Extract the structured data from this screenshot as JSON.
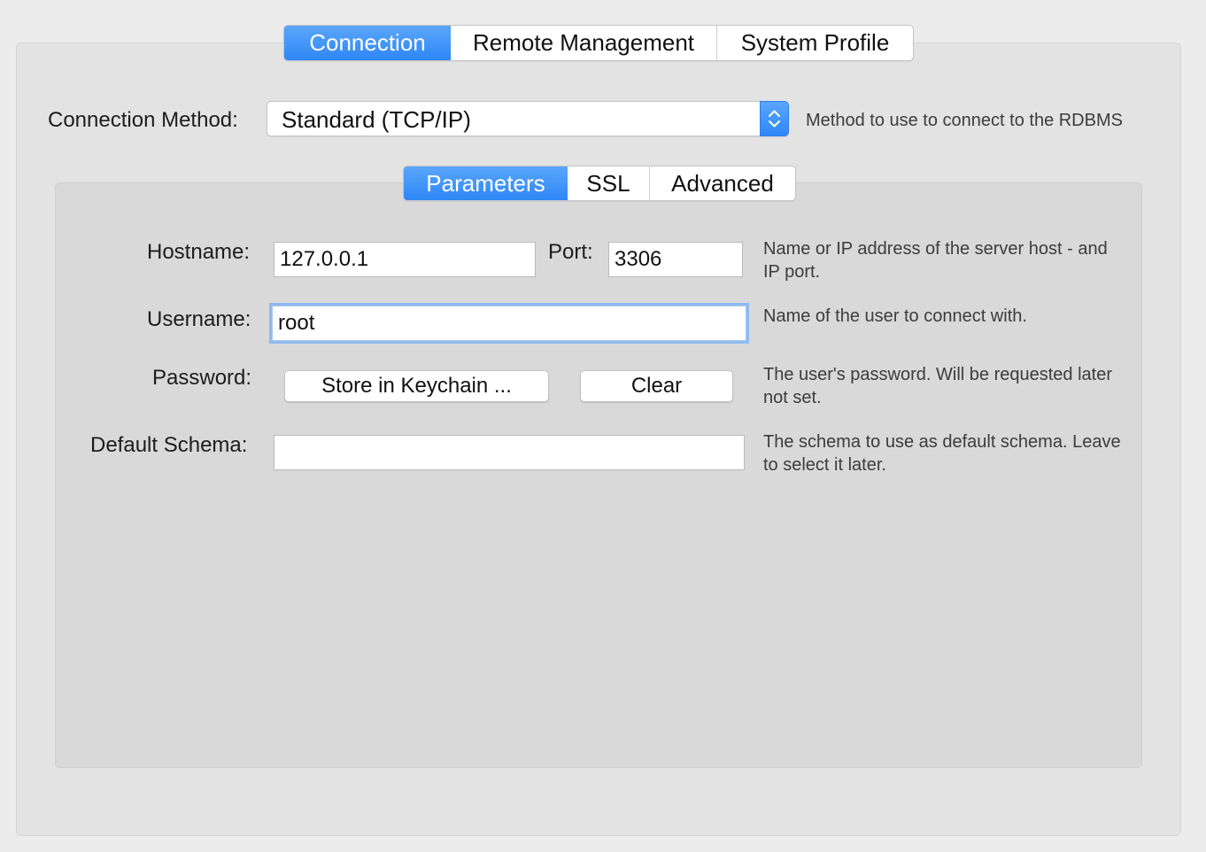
{
  "top_tabs": [
    {
      "label": "Connection",
      "active": true
    },
    {
      "label": "Remote Management",
      "active": false
    },
    {
      "label": "System Profile",
      "active": false
    }
  ],
  "connection_method": {
    "label": "Connection Method:",
    "value": "Standard (TCP/IP)",
    "hint": "Method to use to connect to the RDBMS"
  },
  "sub_tabs": [
    {
      "label": "Parameters",
      "active": true
    },
    {
      "label": "SSL",
      "active": false
    },
    {
      "label": "Advanced",
      "active": false
    }
  ],
  "params": {
    "hostname": {
      "label": "Hostname:",
      "value": "127.0.0.1",
      "hint_line1": "Name or IP address of the server host - and",
      "hint_line2": "IP port."
    },
    "port": {
      "label": "Port:",
      "value": "3306"
    },
    "username": {
      "label": "Username:",
      "value": "root",
      "hint": "Name of the user to connect with."
    },
    "password": {
      "label": "Password:",
      "store_button": "Store in Keychain ...",
      "clear_button": "Clear",
      "hint_line1": "The user's password. Will be requested later",
      "hint_line2": "not set."
    },
    "default_schema": {
      "label": "Default Schema:",
      "value": "",
      "hint_line1": "The schema to use as default schema. Leave",
      "hint_line2": "to select it later."
    }
  },
  "colors": {
    "accent": "#2e86f6",
    "panel_bg": "#e3e3e3",
    "inner_panel_bg": "#d9d9d9",
    "focus_ring": "#8fbaf0"
  }
}
